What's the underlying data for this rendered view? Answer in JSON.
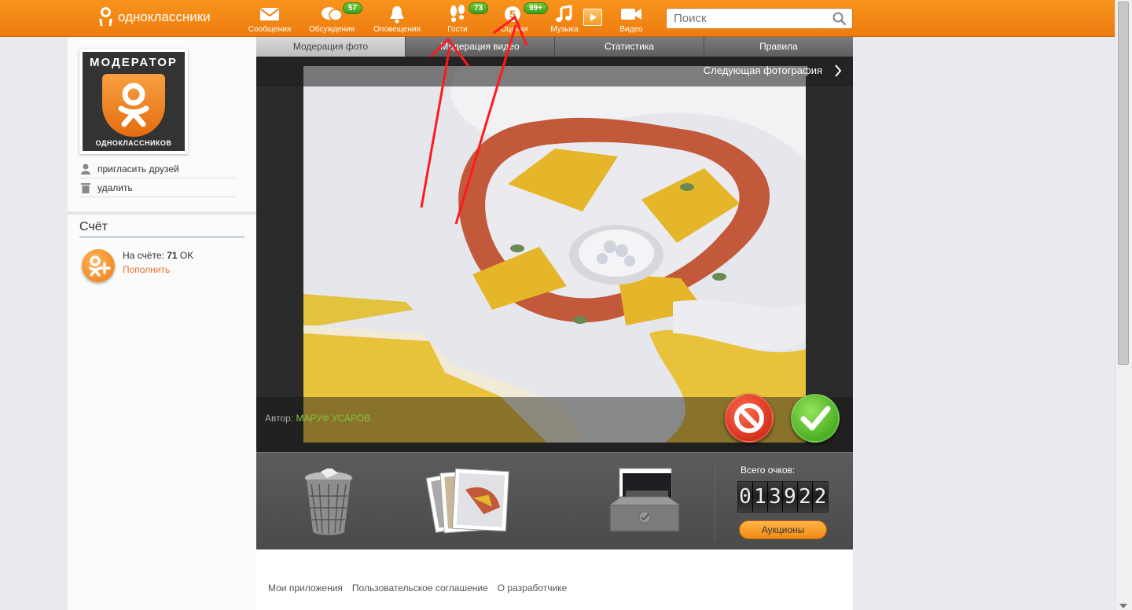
{
  "header": {
    "logo_text": "одноклассники",
    "nav": [
      {
        "label": "Сообщения",
        "icon": "envelope-icon"
      },
      {
        "label": "Обсуждения",
        "icon": "speech-bubbles-icon",
        "badge": "57"
      },
      {
        "label": "Оповещения",
        "icon": "bell-icon"
      },
      {
        "label": "Гости",
        "icon": "footprints-icon",
        "badge": "73"
      },
      {
        "label": "Оценки",
        "icon": "rating-five-icon",
        "badge": "99+"
      },
      {
        "label": "Музыка",
        "icon": "music-note-icon"
      },
      {
        "label": "Видео",
        "icon": "video-camera-icon"
      }
    ],
    "search_placeholder": "Поиск"
  },
  "sidebar": {
    "avatar": {
      "top_text": "МОДЕРАТОР",
      "bottom_text": "ОДНОКЛАССНИКОВ"
    },
    "links": [
      {
        "label": "пригласить друзей",
        "icon": "person-icon"
      },
      {
        "label": "удалить",
        "icon": "trash-icon"
      }
    ],
    "account": {
      "title": "Счёт",
      "balance_label": "На счёте:",
      "balance_value": "71",
      "balance_unit": "OK",
      "topup_label": "Пополнить"
    }
  },
  "main": {
    "tabs": [
      {
        "label": "Модерация фото",
        "active": true
      },
      {
        "label": "Модерация видео",
        "active": false
      },
      {
        "label": "Статистика",
        "active": false
      },
      {
        "label": "Правила",
        "active": false
      }
    ],
    "next_photo_label": "Следующая фотография",
    "author_label": "Автор:",
    "author_name": "МАРУФ УСАРОВ",
    "tray": {
      "total_label": "Всего очков:",
      "score_digits": [
        "0",
        "1",
        "3",
        "9",
        "2",
        "2"
      ],
      "auctions_label": "Аукционы"
    },
    "footer_links": [
      "Мои приложения",
      "Пользовательское соглашение",
      "О разработчике"
    ]
  },
  "colors": {
    "brand_orange": "#f7941d",
    "badge_green": "#4fae22",
    "author_green": "#86c13c",
    "reject_red": "#d9260f",
    "approve_green": "#3aa812"
  }
}
